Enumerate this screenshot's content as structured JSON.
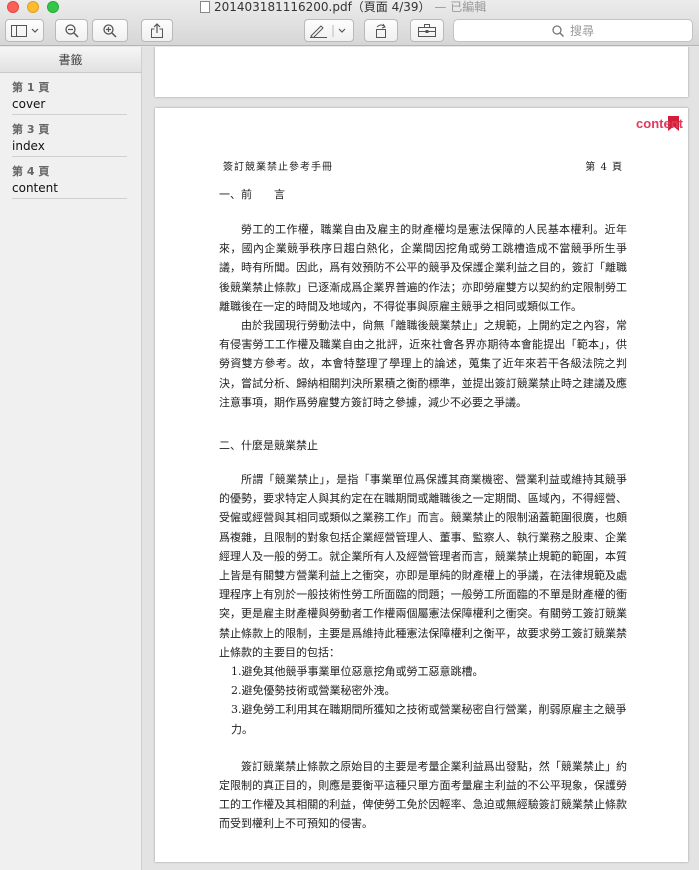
{
  "window": {
    "title": "201403181116200.pdf（頁面 4/39）",
    "edited": "— 已編輯"
  },
  "toolbar": {
    "search_placeholder": "搜尋"
  },
  "sidebar": {
    "header": "書籤",
    "items": [
      {
        "page": "第 1 頁",
        "label": "cover"
      },
      {
        "page": "第 3 頁",
        "label": "index"
      },
      {
        "page": "第 4 頁",
        "label": "content"
      }
    ]
  },
  "document": {
    "bookmark_tag": "content",
    "running_head": "簽訂競業禁止參考手冊",
    "page_number": "第 4 頁",
    "section1_title": "一、前　　言",
    "section1_p1": "勞工的工作權，職業自由及雇主的財產權均是憲法保障的人民基本權利。近年來，國內企業競爭秩序日趨白熱化，企業間因挖角或勞工跳槽造成不當競爭所生爭議，時有所聞。因此，爲有效預防不公平的競爭及保護企業利益之目的，簽訂「離職後競業禁止條款」已逐漸成爲企業界普遍的作法；亦即勞雇雙方以契約約定限制勞工離職後在一定的時間及地域內，不得從事與原雇主競爭之相同或類似工作。",
    "section1_p2": "由於我國現行勞動法中，尙無「離職後競業禁止」之規範，上開約定之內容，常有侵害勞工工作權及職業自由之批評，近來社會各界亦期待本會能提出「範本」，供勞資雙方參考。故，本會特整理了學理上的論述，蒐集了近年來若干各級法院之判決，嘗試分析、歸納相關判決所累積之衡酌標準，並提出簽訂競業禁止時之建議及應注意事項，期作爲勞雇雙方簽訂時之參據，減少不必要之爭議。",
    "section2_title": "二、什麼是競業禁止",
    "section2_p1": "所謂「競業禁止」，是指「事業單位爲保護其商業機密、營業利益或維持其競爭的優勢，要求特定人與其約定在在職期間或離職後之一定期間、區域內，不得經營、受僱或經營與其相同或類似之業務工作」而言。競業禁止的限制涵蓋範圍很廣，也頗爲複雜，且限制的對象包括企業經營管理人、董事、監察人、執行業務之股東、企業經理人及一般的勞工。就企業所有人及經營管理者而言，競業禁止規範的範圍，本質上皆是有關雙方營業利益上之衝突，亦即是單純的財產權上的爭議，在法律規範及處理程序上有別於一般技術性勞工所面臨的問題；一般勞工所面臨的不單是財產權的衝突，更是雇主財產權與勞動者工作權兩個屬憲法保障權利之衝突。有關勞工簽訂競業禁止條款上的限制，主要是爲維持此種憲法保障權利之衡平，故要求勞工簽訂競業禁止條款的主要目的包括：",
    "list": [
      "1.避免其他競爭事業單位惡意挖角或勞工惡意跳槽。",
      "2.避免優勢技術或營業秘密外洩。",
      "3.避免勞工利用其在職期間所獲知之技術或營業秘密自行營業，削弱原雇主之競爭力。"
    ],
    "section2_p2": "簽訂競業禁止條款之原始目的主要是考量企業利益爲出發點，然「競業禁止」約定限制的真正目的，則應是要衡平這種只單方面考量雇主利益的不公平現象，保護勞工的工作權及其相關的利益，俾使勞工免於因輕率、急迫或無經驗簽訂競業禁止條款而受到權利上不可預知的侵害。"
  }
}
